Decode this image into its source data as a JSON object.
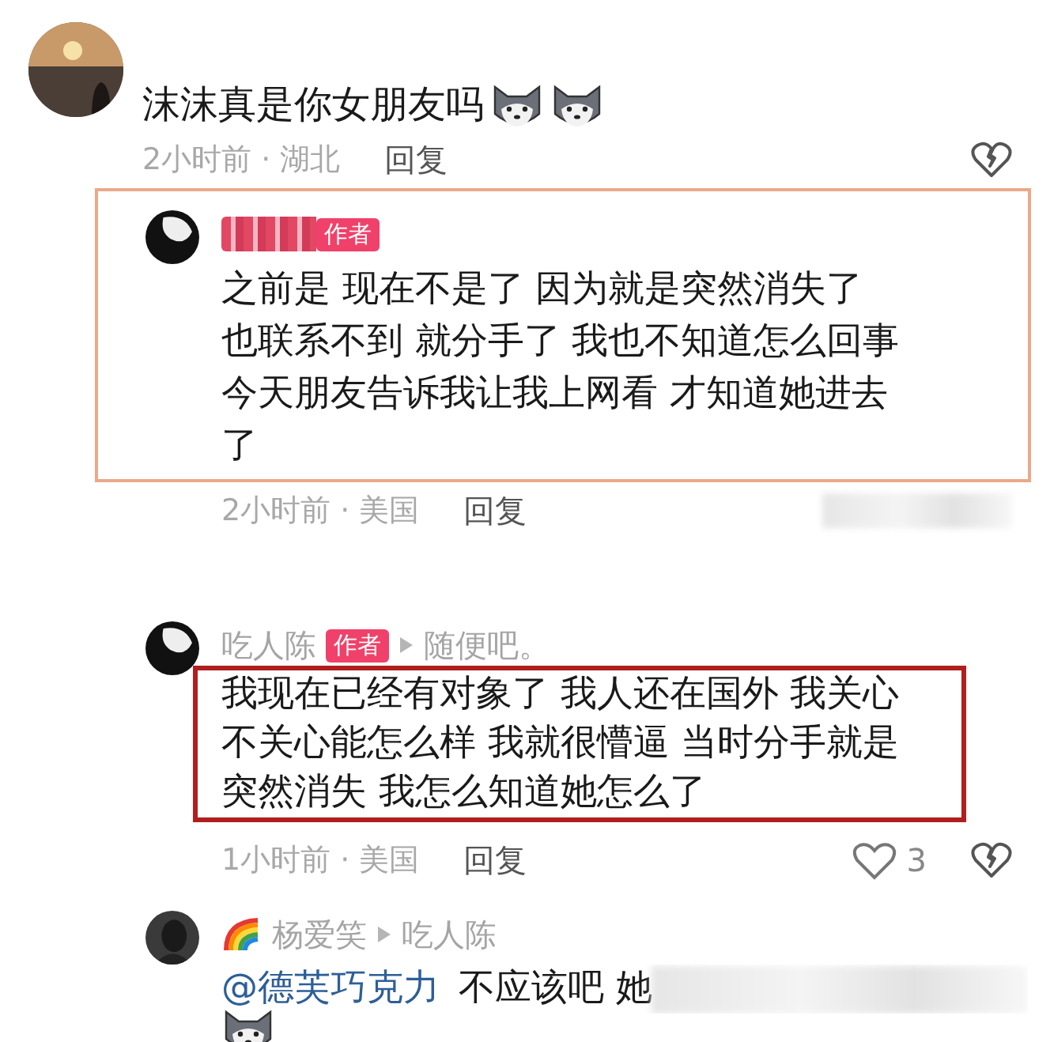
{
  "top_comment": {
    "text": "沫沫真是你女朋友吗",
    "emojis": [
      {
        "kind": "husky"
      },
      {
        "kind": "husky"
      }
    ],
    "meta": "2小时前 · 湖北",
    "reply_button": "回复"
  },
  "replies": [
    {
      "framed": true,
      "author_redacted": true,
      "badge": "作者",
      "lines": [
        "之前是 现在不是了  因为就是突然消失了",
        "也联系不到 就分手了  我也不知道怎么回事",
        "今天朋友告诉我让我上网看 才知道她进去",
        "了"
      ],
      "meta": "2小时前 · 美国",
      "reply_button": "回复",
      "likes_redacted": true
    },
    {
      "text_framed": true,
      "author": "吃人陈",
      "badge": "作者",
      "reply_to": "随便吧。",
      "lines": [
        "我现在已经有对象了 我人还在国外 我关心",
        "不关心能怎么样 我就很懵逼 当时分手就是",
        "突然消失 我怎么知道她怎么了"
      ],
      "meta": "1小时前 · 美国",
      "reply_button": "回复",
      "likes": "3"
    },
    {
      "author_emoji": {
        "kind": "rainbow"
      },
      "author": "杨爱笑",
      "reply_to": "吃人陈",
      "mention": "@德芙巧克力",
      "lines": [
        "不应该吧 她"
      ],
      "text_redacted": true,
      "emojis": [
        {
          "kind": "husky"
        }
      ]
    }
  ]
}
